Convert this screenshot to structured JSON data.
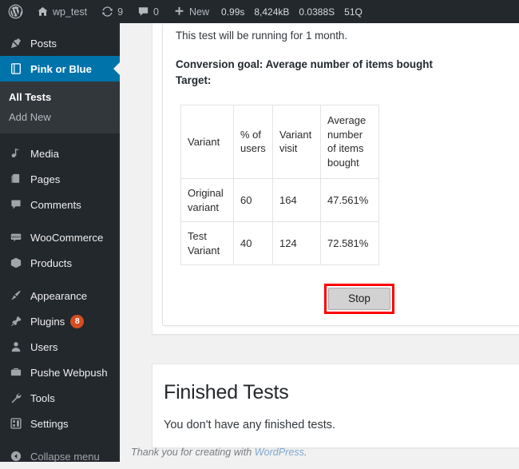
{
  "adminbar": {
    "site_name": "wp_test",
    "updates_count": "9",
    "comments_count": "0",
    "new_label": "New",
    "stats": [
      "0.99s",
      "8,424kB",
      "0.0388S",
      "51Q"
    ],
    "icons": {
      "wordpress": "wordpress-logo-icon",
      "home": "home-icon",
      "updates": "updates-icon",
      "comments": "comment-bubble-icon",
      "new": "plus-icon"
    }
  },
  "sidebar": {
    "items": [
      {
        "label": "Posts",
        "icon": "pin-icon",
        "active": false
      },
      {
        "label": "Pink or Blue",
        "icon": "book-icon",
        "active": true
      },
      {
        "label": "Media",
        "icon": "media-icon",
        "active": false
      },
      {
        "label": "Pages",
        "icon": "pages-icon",
        "active": false
      },
      {
        "label": "Comments",
        "icon": "comment-bubble-icon",
        "active": false
      },
      {
        "label": "WooCommerce",
        "icon": "woocommerce-icon",
        "active": false
      },
      {
        "label": "Products",
        "icon": "products-box-icon",
        "active": false
      },
      {
        "label": "Appearance",
        "icon": "paintbrush-icon",
        "active": false
      },
      {
        "label": "Plugins",
        "icon": "plug-icon",
        "active": false,
        "badge": "8"
      },
      {
        "label": "Users",
        "icon": "user-icon",
        "active": false
      },
      {
        "label": "Pushe Webpush",
        "icon": "briefcase-icon",
        "active": false
      },
      {
        "label": "Tools",
        "icon": "wrench-icon",
        "active": false
      },
      {
        "label": "Settings",
        "icon": "settings-sliders-icon",
        "active": false
      },
      {
        "label": "Collapse menu",
        "icon": "collapse-arrow-icon",
        "active": false
      }
    ],
    "submenu": [
      {
        "label": "All Tests",
        "current": true
      },
      {
        "label": "Add New",
        "current": false
      }
    ],
    "badge_color": "#d54e21",
    "active_color": "#0073aa"
  },
  "running_test": {
    "duration_text": "This test will be running for 1 month.",
    "conversion_goal": "Conversion goal: Average number of items bought",
    "target_label": "Target:",
    "table": {
      "headers": [
        "Variant",
        "% of users",
        "Variant visit",
        "Average number of items bought"
      ],
      "rows": [
        [
          "Original variant",
          "60",
          "164",
          "47.561%"
        ],
        [
          "Test Variant",
          "40",
          "124",
          "72.581%"
        ]
      ]
    },
    "stop_button": "Stop",
    "highlight_color": "#ff0000"
  },
  "finished_tests": {
    "title": "Finished Tests",
    "empty_message": "You don't have any finished tests."
  },
  "footer": {
    "thanks_prefix": "Thank you for creating with ",
    "link_label": "WordPress",
    "suffix": "."
  }
}
